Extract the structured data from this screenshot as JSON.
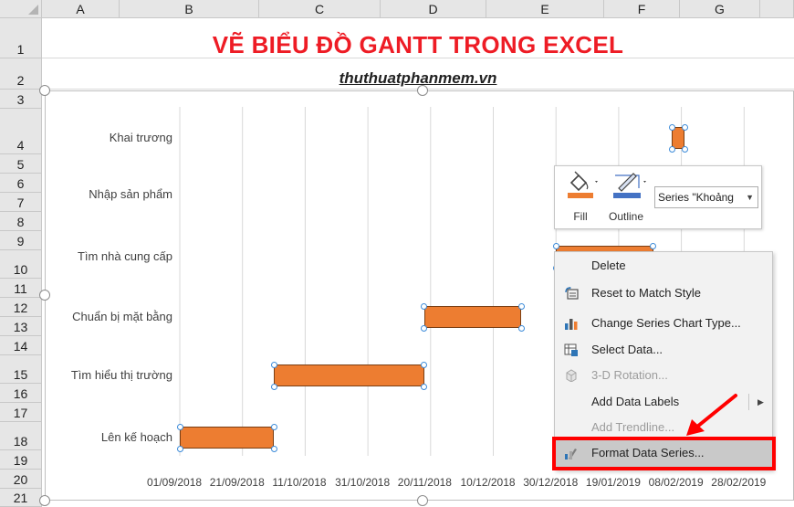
{
  "spreadsheet": {
    "columns": [
      "A",
      "B",
      "C",
      "D",
      "E",
      "F",
      "G"
    ],
    "rows": [
      "1",
      "2",
      "3",
      "4",
      "5",
      "6",
      "7",
      "8",
      "9",
      "10",
      "11",
      "12",
      "13",
      "14",
      "15",
      "16",
      "17",
      "18",
      "19",
      "20",
      "21"
    ],
    "title": "VẼ BIỂU ĐỒ GANTT TRONG EXCEL",
    "subtitle": "thuthuatphanmem.vn"
  },
  "chart_data": {
    "type": "bar",
    "orientation": "horizontal",
    "title": "",
    "categories": [
      "Khai trương",
      "Nhập sản phẩm",
      "Tìm nhà cung cấp",
      "Chuẩn bị mặt bằng",
      "Tìm hiểu thị trường",
      "Lên kế hoạch"
    ],
    "x_tick_labels": [
      "01/09/2018",
      "21/09/2018",
      "11/10/2018",
      "31/10/2018",
      "20/11/2018",
      "10/12/2018",
      "30/12/2018",
      "19/01/2019",
      "08/02/2019",
      "28/02/2019"
    ],
    "xlim": [
      "01/09/2018",
      "28/02/2019"
    ],
    "grid": true,
    "series": [
      {
        "start": "05/02/2019",
        "end": "09/02/2019",
        "color": "#ed7d31"
      },
      {
        "start": "",
        "end": "",
        "color": "#ed7d31"
      },
      {
        "start": "30/12/2018",
        "end": "30/01/2019",
        "color": "#ed7d31"
      },
      {
        "start": "18/11/2018",
        "end": "19/12/2018",
        "color": "#ed7d31"
      },
      {
        "start": "01/10/2018",
        "end": "18/11/2018",
        "color": "#ed7d31"
      },
      {
        "start": "01/09/2018",
        "end": "01/10/2018",
        "color": "#ed7d31"
      }
    ]
  },
  "mini_toolbar": {
    "fill_label": "Fill",
    "outline_label": "Outline",
    "series_select": "Series \"Khoảng"
  },
  "context_menu": {
    "items": [
      {
        "label": "Delete",
        "icon": "",
        "disabled": false
      },
      {
        "label": "Reset to Match Style",
        "icon": "reset-style-icon",
        "disabled": false
      },
      {
        "label": "Change Series Chart Type...",
        "icon": "chart-type-icon",
        "disabled": false
      },
      {
        "label": "Select Data...",
        "icon": "select-data-icon",
        "disabled": false
      },
      {
        "label": "3-D Rotation...",
        "icon": "cube-icon",
        "disabled": true
      },
      {
        "label": "Add Data Labels",
        "icon": "",
        "disabled": false
      },
      {
        "label": "Add Trendline...",
        "icon": "",
        "disabled": true
      },
      {
        "label": "Format Data Series...",
        "icon": "format-series-icon",
        "disabled": false
      }
    ]
  },
  "colors": {
    "bar": "#ed7d31",
    "title": "#ee1c25",
    "highlight": "#ff0000",
    "selection": "#3c8bd9"
  }
}
